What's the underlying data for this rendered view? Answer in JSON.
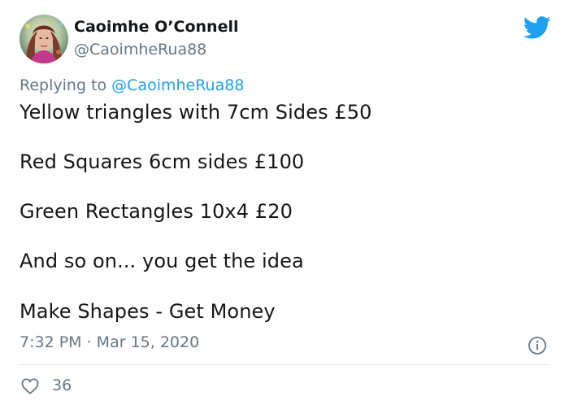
{
  "user": {
    "display_name": "Caoimhe O’Connell",
    "handle": "@CaoimheRua88"
  },
  "reply": {
    "prefix": "Replying to ",
    "mention": "@CaoimheRua88"
  },
  "body": {
    "lines": [
      "Yellow triangles with 7cm Sides £50",
      "Red Squares 6cm sides £100",
      "Green Rectangles 10x4 £20",
      "And so on... you get the idea",
      "Make Shapes - Get Money"
    ]
  },
  "meta": {
    "timestamp": "7:32 PM · Mar 15, 2020",
    "likes": "36"
  },
  "icons": {
    "brand": "twitter-bird-icon",
    "info": "info-icon",
    "like": "heart-icon"
  },
  "colors": {
    "brand_blue": "#1da1f2",
    "text_primary": "#14171a",
    "text_secondary": "#657786",
    "divider": "#e1e8ed"
  }
}
